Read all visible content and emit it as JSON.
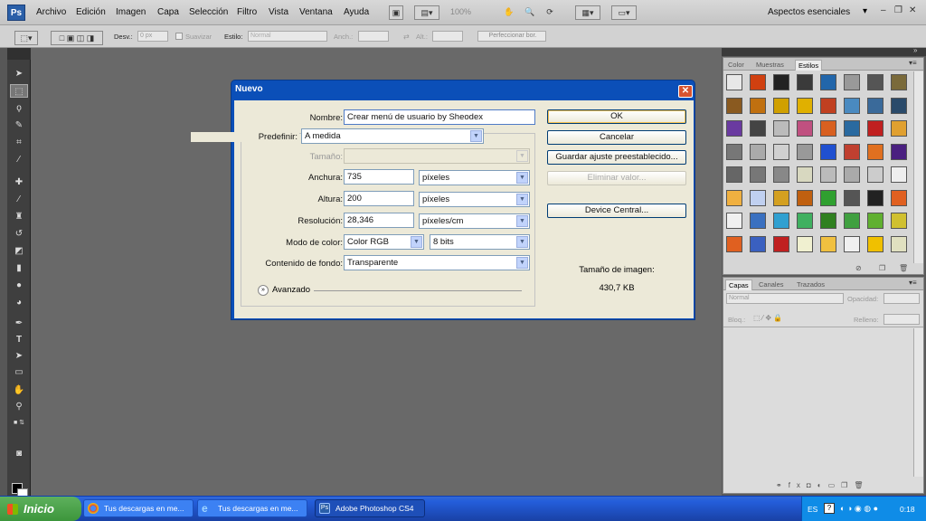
{
  "menubar": {
    "logo": "Ps",
    "items": [
      "Archivo",
      "Edición",
      "Imagen",
      "Capa",
      "Selección",
      "Filtro",
      "Vista",
      "Ventana",
      "Ayuda"
    ],
    "zoom": "100%",
    "workspace": "Aspectos esenciales"
  },
  "options": {
    "feather_label": "Desv.:",
    "feather_value": "0 px",
    "antialias_label": "Suavizar",
    "style_label": "Estilo:",
    "style_value": "Normal",
    "width_label": "Anch.:",
    "height_label": "Alt.:",
    "refine_label": "Perfeccionar bor."
  },
  "right_panels": {
    "styles_tabs": [
      "Color",
      "Muestras",
      "Estilos"
    ],
    "layers_tabs": [
      "Capas",
      "Canales",
      "Trazados"
    ],
    "blend_mode": "Normal",
    "opacity_label": "Opacidad:",
    "lock_label": "Bloq.:",
    "fill_label": "Relleno:"
  },
  "dialog": {
    "title": "Nuevo",
    "name_label": "Nombre:",
    "name_value": "Crear menú de usuario by Sheodex",
    "preset_label": "Predefinir:",
    "preset_value": "A medida",
    "size_label": "Tamaño:",
    "width_label": "Anchura:",
    "width_value": "735",
    "width_unit": "píxeles",
    "height_label": "Altura:",
    "height_value": "200",
    "height_unit": "píxeles",
    "resolution_label": "Resolución:",
    "resolution_value": "28,346",
    "resolution_unit": "píxeles/cm",
    "color_mode_label": "Modo de color:",
    "color_mode_value": "Color RGB",
    "bit_depth_value": "8 bits",
    "background_label": "Contenido de fondo:",
    "background_value": "Transparente",
    "advanced_label": "Avanzado",
    "ok_label": "OK",
    "cancel_label": "Cancelar",
    "save_preset_label": "Guardar ajuste preestablecido...",
    "delete_preset_label": "Eliminar valor...",
    "device_central_label": "Device Central...",
    "image_size_label": "Tamaño de imagen:",
    "image_size_value": "430,7 KB"
  },
  "taskbar": {
    "start_label": "Inicio",
    "tasks": [
      "Tus descargas en me...",
      "Tus descargas en me...",
      "Adobe Photoshop CS4"
    ],
    "lang": "ES",
    "time": "0:18"
  },
  "colors": {
    "dialog_title_bar": "#0b4fb8",
    "taskbar": "#245edb",
    "start_button": "#3c963b",
    "workspace_bg": "#696969"
  }
}
